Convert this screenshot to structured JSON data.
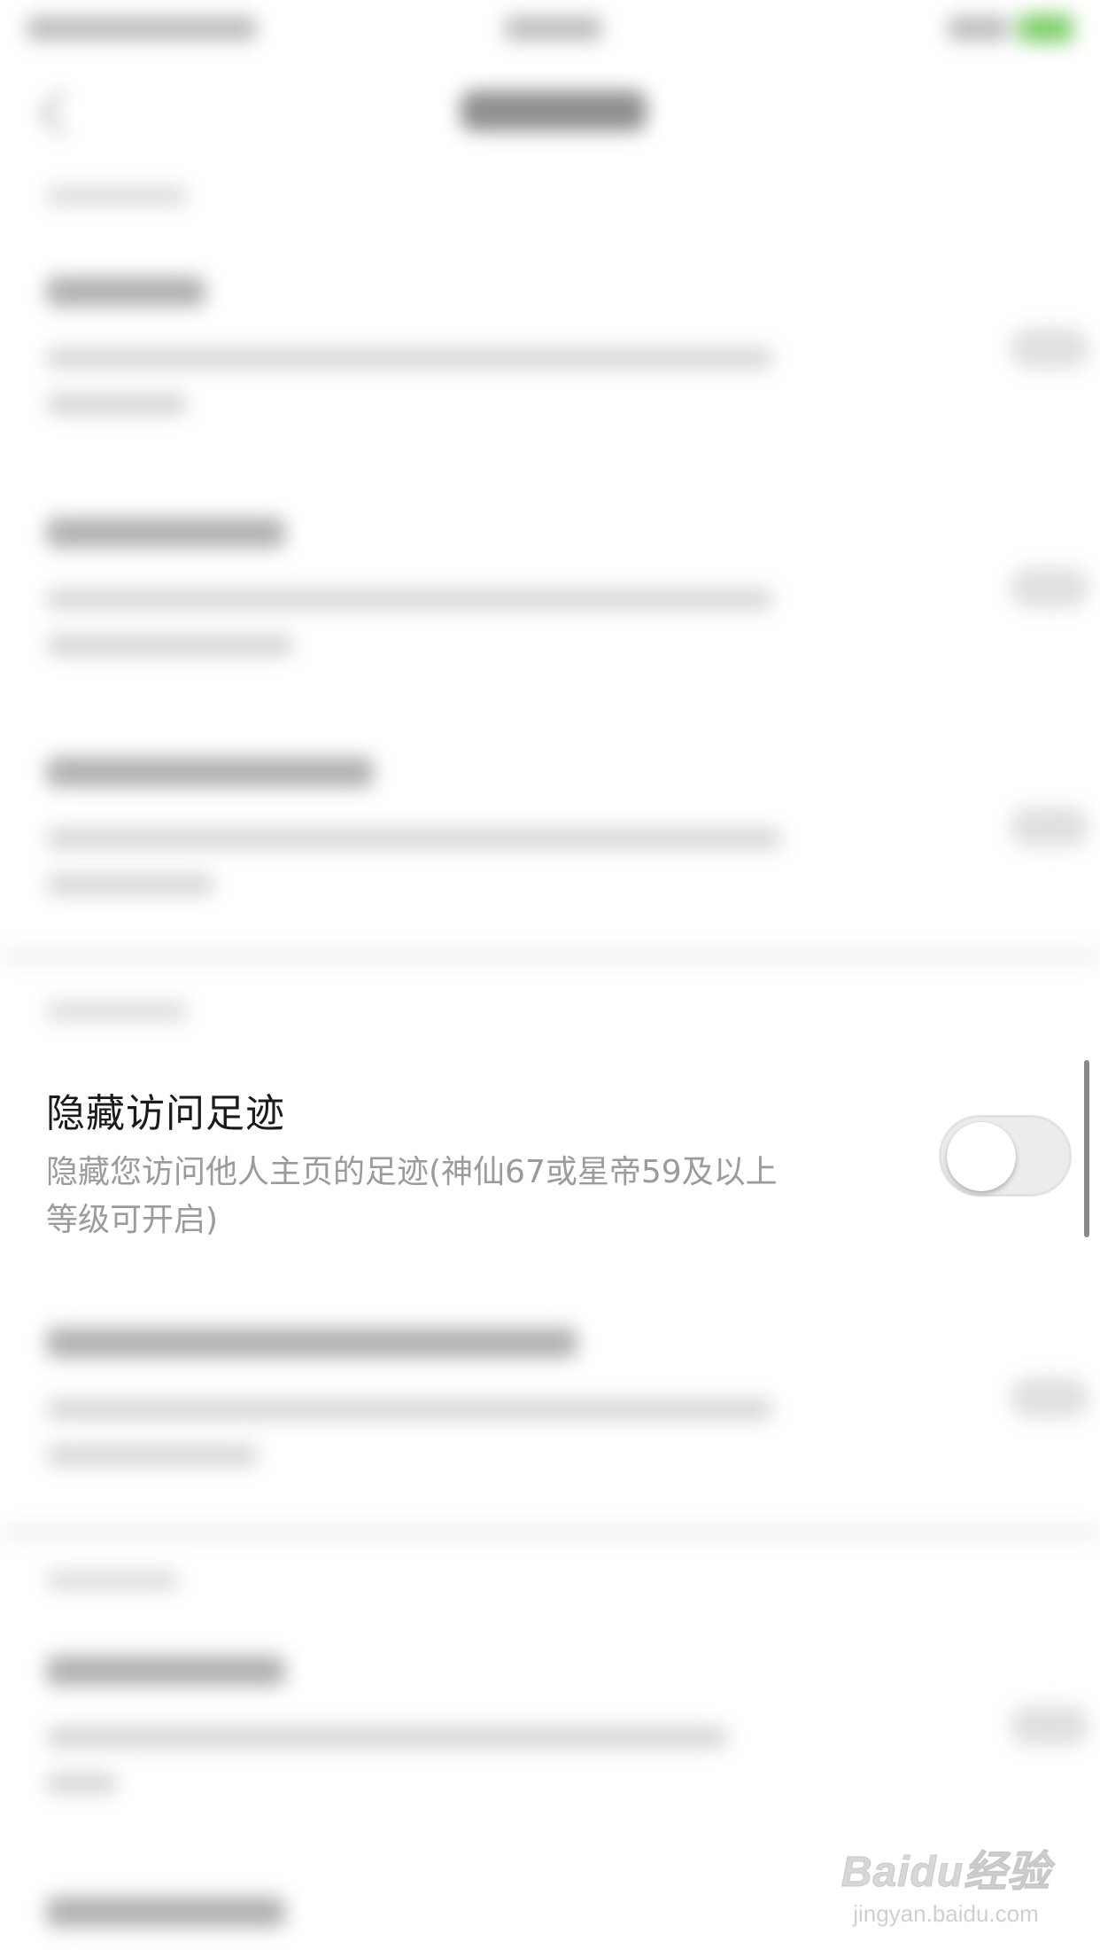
{
  "setting": {
    "title": "隐藏访问足迹",
    "description": "隐藏您访问他人主页的足迹(神仙67或星帝59及以上等级可开启)",
    "toggle_on": false
  },
  "watermark": {
    "logo": "Baidu经验",
    "url": "jingyan.baidu.com"
  },
  "colors": {
    "title_text": "#1b1b1b",
    "desc_text": "#9a9a9f",
    "toggle_off": "#ececec",
    "battery_green": "#7ccf6a"
  }
}
